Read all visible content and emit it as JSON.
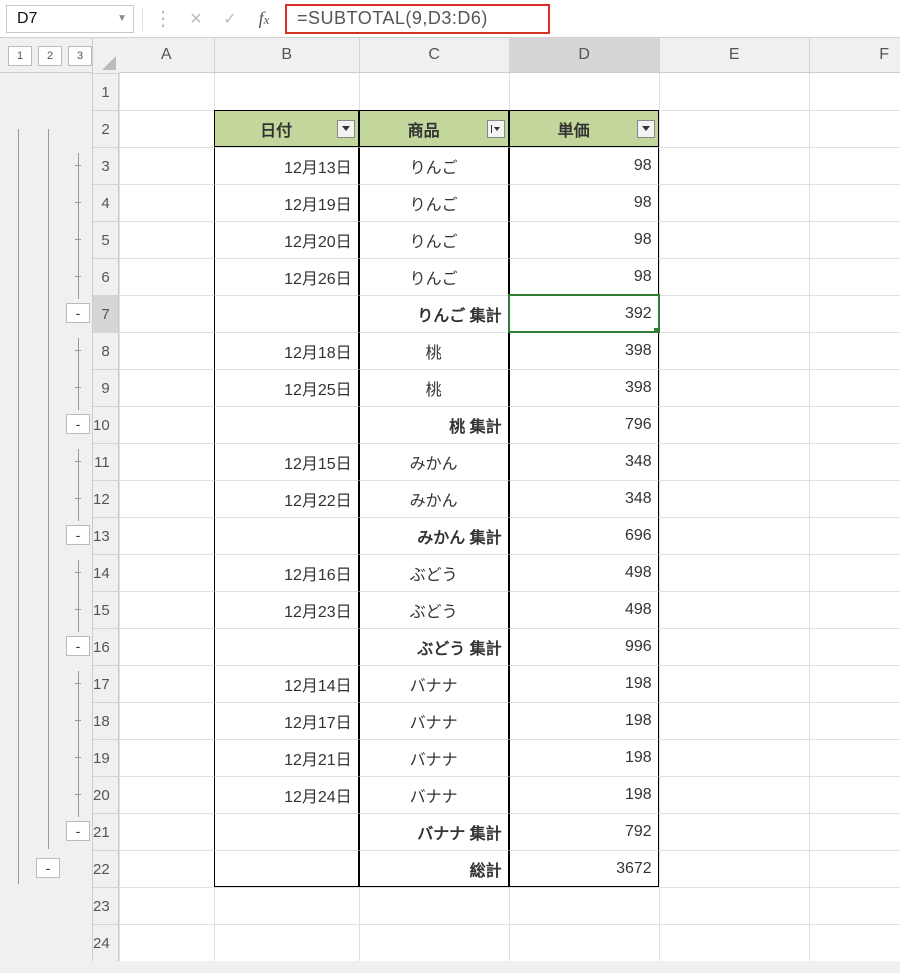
{
  "name_box": "D7",
  "formula": "=SUBTOTAL(9,D3:D6)",
  "outline_levels": [
    "1",
    "2",
    "3"
  ],
  "col_labels": {
    "A": "A",
    "B": "B",
    "C": "C",
    "D": "D",
    "E": "E",
    "F": "F"
  },
  "row_labels": [
    "1",
    "2",
    "3",
    "4",
    "5",
    "6",
    "7",
    "8",
    "9",
    "10",
    "11",
    "12",
    "13",
    "14",
    "15",
    "16",
    "17",
    "18",
    "19",
    "20",
    "21",
    "22",
    "23",
    "24"
  ],
  "headers": {
    "date": "日付",
    "product": "商品",
    "price": "単価"
  },
  "rows": {
    "r3": {
      "date": "12月13日",
      "product": "りんご",
      "price": "98"
    },
    "r4": {
      "date": "12月19日",
      "product": "りんご",
      "price": "98"
    },
    "r5": {
      "date": "12月20日",
      "product": "りんご",
      "price": "98"
    },
    "r6": {
      "date": "12月26日",
      "product": "りんご",
      "price": "98"
    },
    "r7": {
      "date": "",
      "product": "りんご 集計",
      "price": "392"
    },
    "r8": {
      "date": "12月18日",
      "product": "桃",
      "price": "398"
    },
    "r9": {
      "date": "12月25日",
      "product": "桃",
      "price": "398"
    },
    "r10": {
      "date": "",
      "product": "桃 集計",
      "price": "796"
    },
    "r11": {
      "date": "12月15日",
      "product": "みかん",
      "price": "348"
    },
    "r12": {
      "date": "12月22日",
      "product": "みかん",
      "price": "348"
    },
    "r13": {
      "date": "",
      "product": "みかん 集計",
      "price": "696"
    },
    "r14": {
      "date": "12月16日",
      "product": "ぶどう",
      "price": "498"
    },
    "r15": {
      "date": "12月23日",
      "product": "ぶどう",
      "price": "498"
    },
    "r16": {
      "date": "",
      "product": "ぶどう 集計",
      "price": "996"
    },
    "r17": {
      "date": "12月14日",
      "product": "バナナ",
      "price": "198"
    },
    "r18": {
      "date": "12月17日",
      "product": "バナナ",
      "price": "198"
    },
    "r19": {
      "date": "12月21日",
      "product": "バナナ",
      "price": "198"
    },
    "r20": {
      "date": "12月24日",
      "product": "バナナ",
      "price": "198"
    },
    "r21": {
      "date": "",
      "product": "バナナ 集計",
      "price": "792"
    },
    "r22": {
      "date": "",
      "product": "総計",
      "price": "3672"
    }
  },
  "outline_collapse_label": "-",
  "selected_cell": "D7",
  "active_row": "7",
  "active_col": "D"
}
